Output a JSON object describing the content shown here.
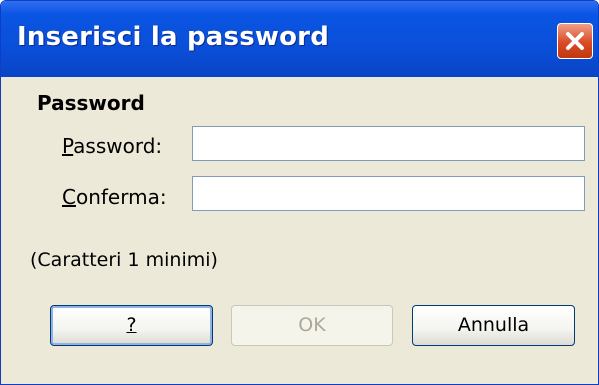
{
  "window": {
    "title": "Inserisci la password"
  },
  "form": {
    "section_title": "Password",
    "password_label_access": "P",
    "password_label_rest": "assword:",
    "password_value": "",
    "confirm_label_access": "C",
    "confirm_label_rest": "onferma:",
    "confirm_value": "",
    "hint": "(Caratteri 1 minimi)"
  },
  "buttons": {
    "help_label": "?",
    "ok_label": "OK",
    "cancel_label": "Annulla"
  },
  "icons": {
    "close": "close-icon"
  },
  "colors": {
    "titlebar": "#0a55e3",
    "close_button": "#d94a25",
    "dialog_background": "#ece9d8",
    "input_border": "#7f9db9",
    "button_border": "#003c74"
  }
}
